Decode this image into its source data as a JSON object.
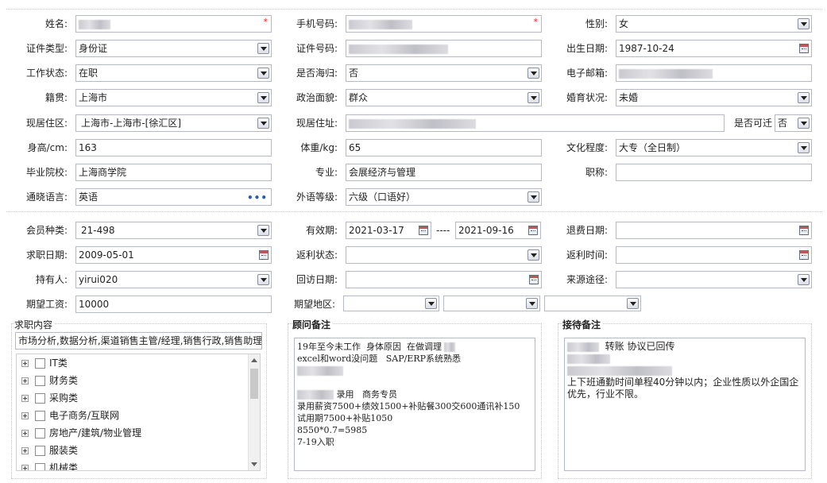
{
  "row1": {
    "name_label": "姓名:",
    "phone_label": "手机号码:",
    "gender_label": "性别:",
    "gender_value": "女",
    "required_mark": "*"
  },
  "row2": {
    "idtype_label": "证件类型:",
    "idtype_value": "身份证",
    "idno_label": "证件号码:",
    "birth_label": "出生日期:",
    "birth_value": "1987-10-24"
  },
  "row3": {
    "work_label": "工作状态:",
    "work_value": "在职",
    "overseas_label": "是否海归:",
    "overseas_value": "否",
    "email_label": "电子邮箱:"
  },
  "row4": {
    "native_label": "籍贯:",
    "native_value": "上海市",
    "political_label": "政治面貌:",
    "political_value": "群众",
    "marital_label": "婚育状况:",
    "marital_value": "未婚"
  },
  "row5": {
    "residence_label": "现居住区:",
    "residence_value": "上海市-上海市-[徐汇区]",
    "address_label": "现居住址:",
    "relocate_label": "是否可迁",
    "relocate_value": "否"
  },
  "row6": {
    "height_label": "身高/cm:",
    "height_value": "163",
    "weight_label": "体重/kg:",
    "weight_value": "65",
    "edu_label": "文化程度:",
    "edu_value": "大专（全日制）"
  },
  "row7": {
    "school_label": "毕业院校:",
    "school_value": "上海商学院",
    "major_label": "专业:",
    "major_value": "会展经济与管理",
    "title_label": "职称:"
  },
  "row8": {
    "lang_label": "通晓语言:",
    "lang_value": "英语",
    "lang_more": "•••",
    "level_label": "外语等级:",
    "level_value": "六级（口语好）"
  },
  "row9": {
    "member_label": "会员种类:",
    "member_value": "21-498",
    "valid_label": "有效期:",
    "valid_from": "2021-03-17",
    "valid_sep": "----",
    "valid_to": "2021-09-16",
    "refund_label": "退费日期:"
  },
  "row10": {
    "apply_label": "求职日期:",
    "apply_value": "2009-05-01",
    "rebate_label": "返利状态:",
    "rebate_time_label": "返利时间:"
  },
  "row11": {
    "holder_label": "持有人:",
    "holder_value": "yirui020",
    "visit_label": "回访日期:",
    "source_label": "来源途径:"
  },
  "row12": {
    "salary_label": "期望工资:",
    "salary_value": "10000",
    "area_label": "期望地区:"
  },
  "job": {
    "title": "求职内容",
    "summary": "市场分析,数据分析,渠道销售主管/经理,销售行政,销售助理",
    "categories": [
      "IT类",
      "财务类",
      "采购类",
      "电子商务/互联网",
      "房地产/建筑/物业管理",
      "服装类",
      "机械类"
    ]
  },
  "advisor": {
    "title": "顾问备注",
    "line1": "19年至今未工作  身体原因  在做调理",
    "line2": "excel和word没问题   SAP/ERP系统熟悉",
    "line4": "录用   商务专员",
    "line5": "录用薪资7500+绩效1500+补贴餐300交600通讯补150",
    "line6": "试用期7500+补贴1050",
    "line7": "8550*0.7=5985",
    "line8": "7-19入职"
  },
  "reception": {
    "title": "接待备注",
    "line1": "转账 协议已回传",
    "line4": "上下班通勤时间单程40分钟以内；企业性质以外企国企优先，行业不限。"
  }
}
